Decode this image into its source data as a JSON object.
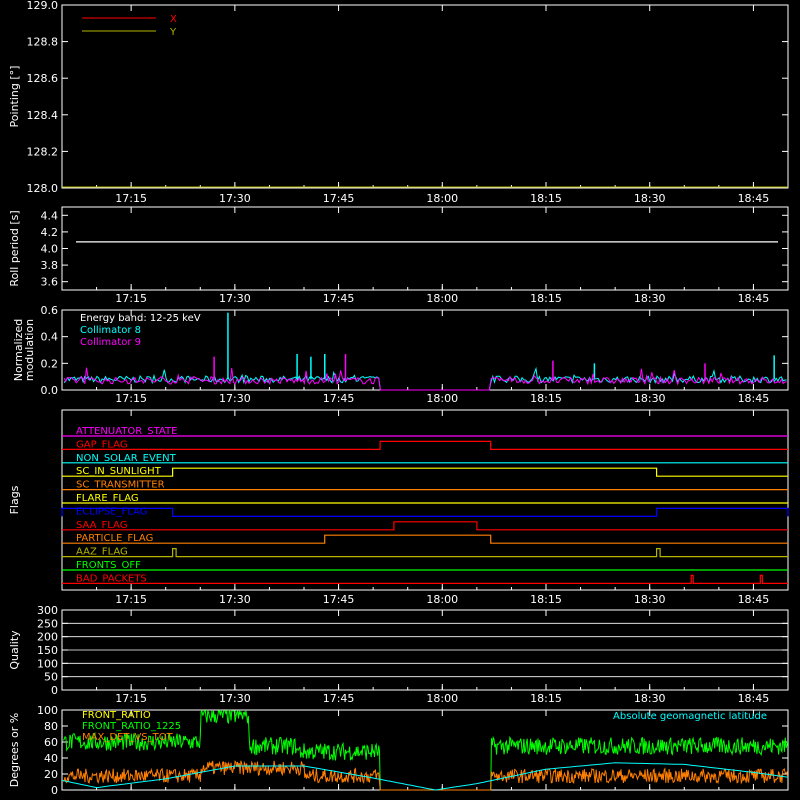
{
  "chart_data": [
    {
      "type": "line",
      "panel": "pointing",
      "ylabel": "Pointing [°]",
      "ylim": [
        128.0,
        129.0
      ],
      "yticks": [
        "128.0",
        "128.2",
        "128.4",
        "128.6",
        "128.8",
        "129.0"
      ],
      "xlim": [
        "17:05",
        "18:50"
      ],
      "xticks": [
        "17:15",
        "17:30",
        "17:45",
        "18:00",
        "18:15",
        "18:30",
        "18:45"
      ],
      "legend": "top-left",
      "series": [
        {
          "name": "X",
          "color": "#ff0000",
          "x": [
            "17:05",
            "18:50"
          ],
          "y": [
            128.0,
            128.0
          ]
        },
        {
          "name": "Y",
          "color": "#b4b400",
          "x": [
            "17:05",
            "18:50"
          ],
          "y": [
            128.0,
            128.0
          ]
        }
      ]
    },
    {
      "type": "line",
      "panel": "roll",
      "ylabel": "Roll period [s]",
      "ylim": [
        3.5,
        4.5
      ],
      "yticks": [
        "3.6",
        "3.8",
        "4.0",
        "4.2",
        "4.4"
      ],
      "xticks": [
        "17:15",
        "17:30",
        "17:45",
        "18:00",
        "18:15",
        "18:30",
        "18:45"
      ],
      "series": [
        {
          "name": "",
          "color": "#ffffff",
          "x": [
            "17:05",
            "18:50"
          ],
          "y": [
            4.08,
            4.08
          ]
        }
      ]
    },
    {
      "type": "line",
      "panel": "modulation",
      "ylabel": "Normalized modulation",
      "ylim": [
        0.0,
        0.6
      ],
      "yticks": [
        "0.0",
        "0.2",
        "0.4",
        "0.6"
      ],
      "xticks": [
        "17:15",
        "17:30",
        "17:45",
        "18:00",
        "18:15",
        "18:30",
        "18:45"
      ],
      "legend": "top-left",
      "annotation": "Energy band: 12-25 keV",
      "gap": [
        "17:51",
        "18:07"
      ],
      "series": [
        {
          "name": "Collimator 8",
          "color": "#00ffff",
          "baseline": 0.08,
          "spikes": [
            [
              "17:29",
              0.58
            ],
            [
              "17:39",
              0.27
            ],
            [
              "17:41",
              0.25
            ],
            [
              "17:43",
              0.27
            ],
            [
              "18:22",
              0.2
            ],
            [
              "18:48",
              0.26
            ]
          ]
        },
        {
          "name": "Collimator 9",
          "color": "#ff00ff",
          "baseline": 0.07,
          "spikes": [
            [
              "17:27",
              0.25
            ],
            [
              "17:46",
              0.27
            ],
            [
              "18:16",
              0.22
            ],
            [
              "18:38",
              0.2
            ]
          ]
        }
      ]
    },
    {
      "type": "line",
      "panel": "flags",
      "ylabel": "Flags",
      "xticks": [
        "17:15",
        "17:30",
        "17:45",
        "18:00",
        "18:15",
        "18:30",
        "18:45"
      ],
      "series": [
        {
          "name": "ATTENUATOR_STATE",
          "color": "#ff00ff",
          "high": []
        },
        {
          "name": "GAP_FLAG",
          "color": "#ff0000",
          "high": [
            [
              "17:51",
              "18:07"
            ]
          ]
        },
        {
          "name": "NON_SOLAR_EVENT",
          "color": "#00ffff",
          "high": []
        },
        {
          "name": "SC_IN_SUNLIGHT",
          "color": "#ffff00",
          "high": [
            [
              "17:21",
              "18:31"
            ]
          ]
        },
        {
          "name": "SC_TRANSMITTER",
          "color": "#ff7f00",
          "high": []
        },
        {
          "name": "FLARE_FLAG",
          "color": "#ffff00",
          "high": []
        },
        {
          "name": "ECLIPSE_FLAG",
          "color": "#0000ff",
          "high": [
            [
              "17:05",
              "17:21"
            ],
            [
              "18:31",
              "18:50"
            ]
          ]
        },
        {
          "name": "SAA_FLAG",
          "color": "#ff0000",
          "high": [
            [
              "17:53",
              "18:05"
            ]
          ]
        },
        {
          "name": "PARTICLE_FLAG",
          "color": "#ff7f00",
          "high": [
            [
              "17:43",
              "18:07"
            ]
          ]
        },
        {
          "name": "AAZ_FLAG",
          "color": "#b4b400",
          "high": [
            [
              "17:21",
              "17:21.5"
            ],
            [
              "18:31",
              "18:31.5"
            ]
          ]
        },
        {
          "name": "FRONTS_OFF",
          "color": "#00ff00",
          "high": []
        },
        {
          "name": "BAD_PACKETS",
          "color": "#ff0000",
          "high": [
            [
              "18:36",
              "18:36.2"
            ],
            [
              "18:46",
              "18:46.2"
            ]
          ]
        }
      ]
    },
    {
      "type": "line",
      "panel": "quality",
      "ylabel": "Quality",
      "ylim": [
        0,
        300
      ],
      "yticks": [
        "0",
        "50",
        "100",
        "150",
        "200",
        "250",
        "300"
      ],
      "xticks": [
        "17:15",
        "17:30",
        "17:45",
        "18:00",
        "18:15",
        "18:30",
        "18:45"
      ],
      "series": []
    },
    {
      "type": "line",
      "panel": "ratios",
      "ylabel": "Degrees or %",
      "ylim": [
        0,
        100
      ],
      "yticks": [
        "0",
        "20",
        "40",
        "60",
        "80",
        "100"
      ],
      "xticks": [
        "17:15",
        "17:30",
        "17:45",
        "18:00",
        "18:15",
        "18:30",
        "18:45"
      ],
      "legend": "top-left",
      "series": [
        {
          "name": "FRONT_RATIO",
          "color": "#ffff00"
        },
        {
          "name": "FRONT_RATIO_1225",
          "color": "#00ff00",
          "segments": [
            [
              "17:05",
              "17:25",
              60
            ],
            [
              "17:25",
              "17:32",
              93
            ],
            [
              "17:32",
              "17:39",
              55
            ],
            [
              "17:39",
              "17:51",
              48
            ],
            [
              "18:07",
              "18:50",
              55
            ]
          ]
        },
        {
          "name": "MAX_DET_VS_TOT",
          "color": "#ff7f00",
          "level": 14
        },
        {
          "name": "Absolute geomagnetic latitude",
          "color": "#00ffff",
          "points": [
            [
              "17:05",
              12
            ],
            [
              "17:10",
              3
            ],
            [
              "17:20",
              14
            ],
            [
              "17:30",
              30
            ],
            [
              "17:40",
              30
            ],
            [
              "17:50",
              15
            ],
            [
              "17:59",
              0
            ],
            [
              "18:05",
              8
            ],
            [
              "18:15",
              26
            ],
            [
              "18:25",
              34
            ],
            [
              "18:35",
              32
            ],
            [
              "18:45",
              22
            ],
            [
              "18:50",
              16
            ]
          ]
        }
      ]
    }
  ]
}
